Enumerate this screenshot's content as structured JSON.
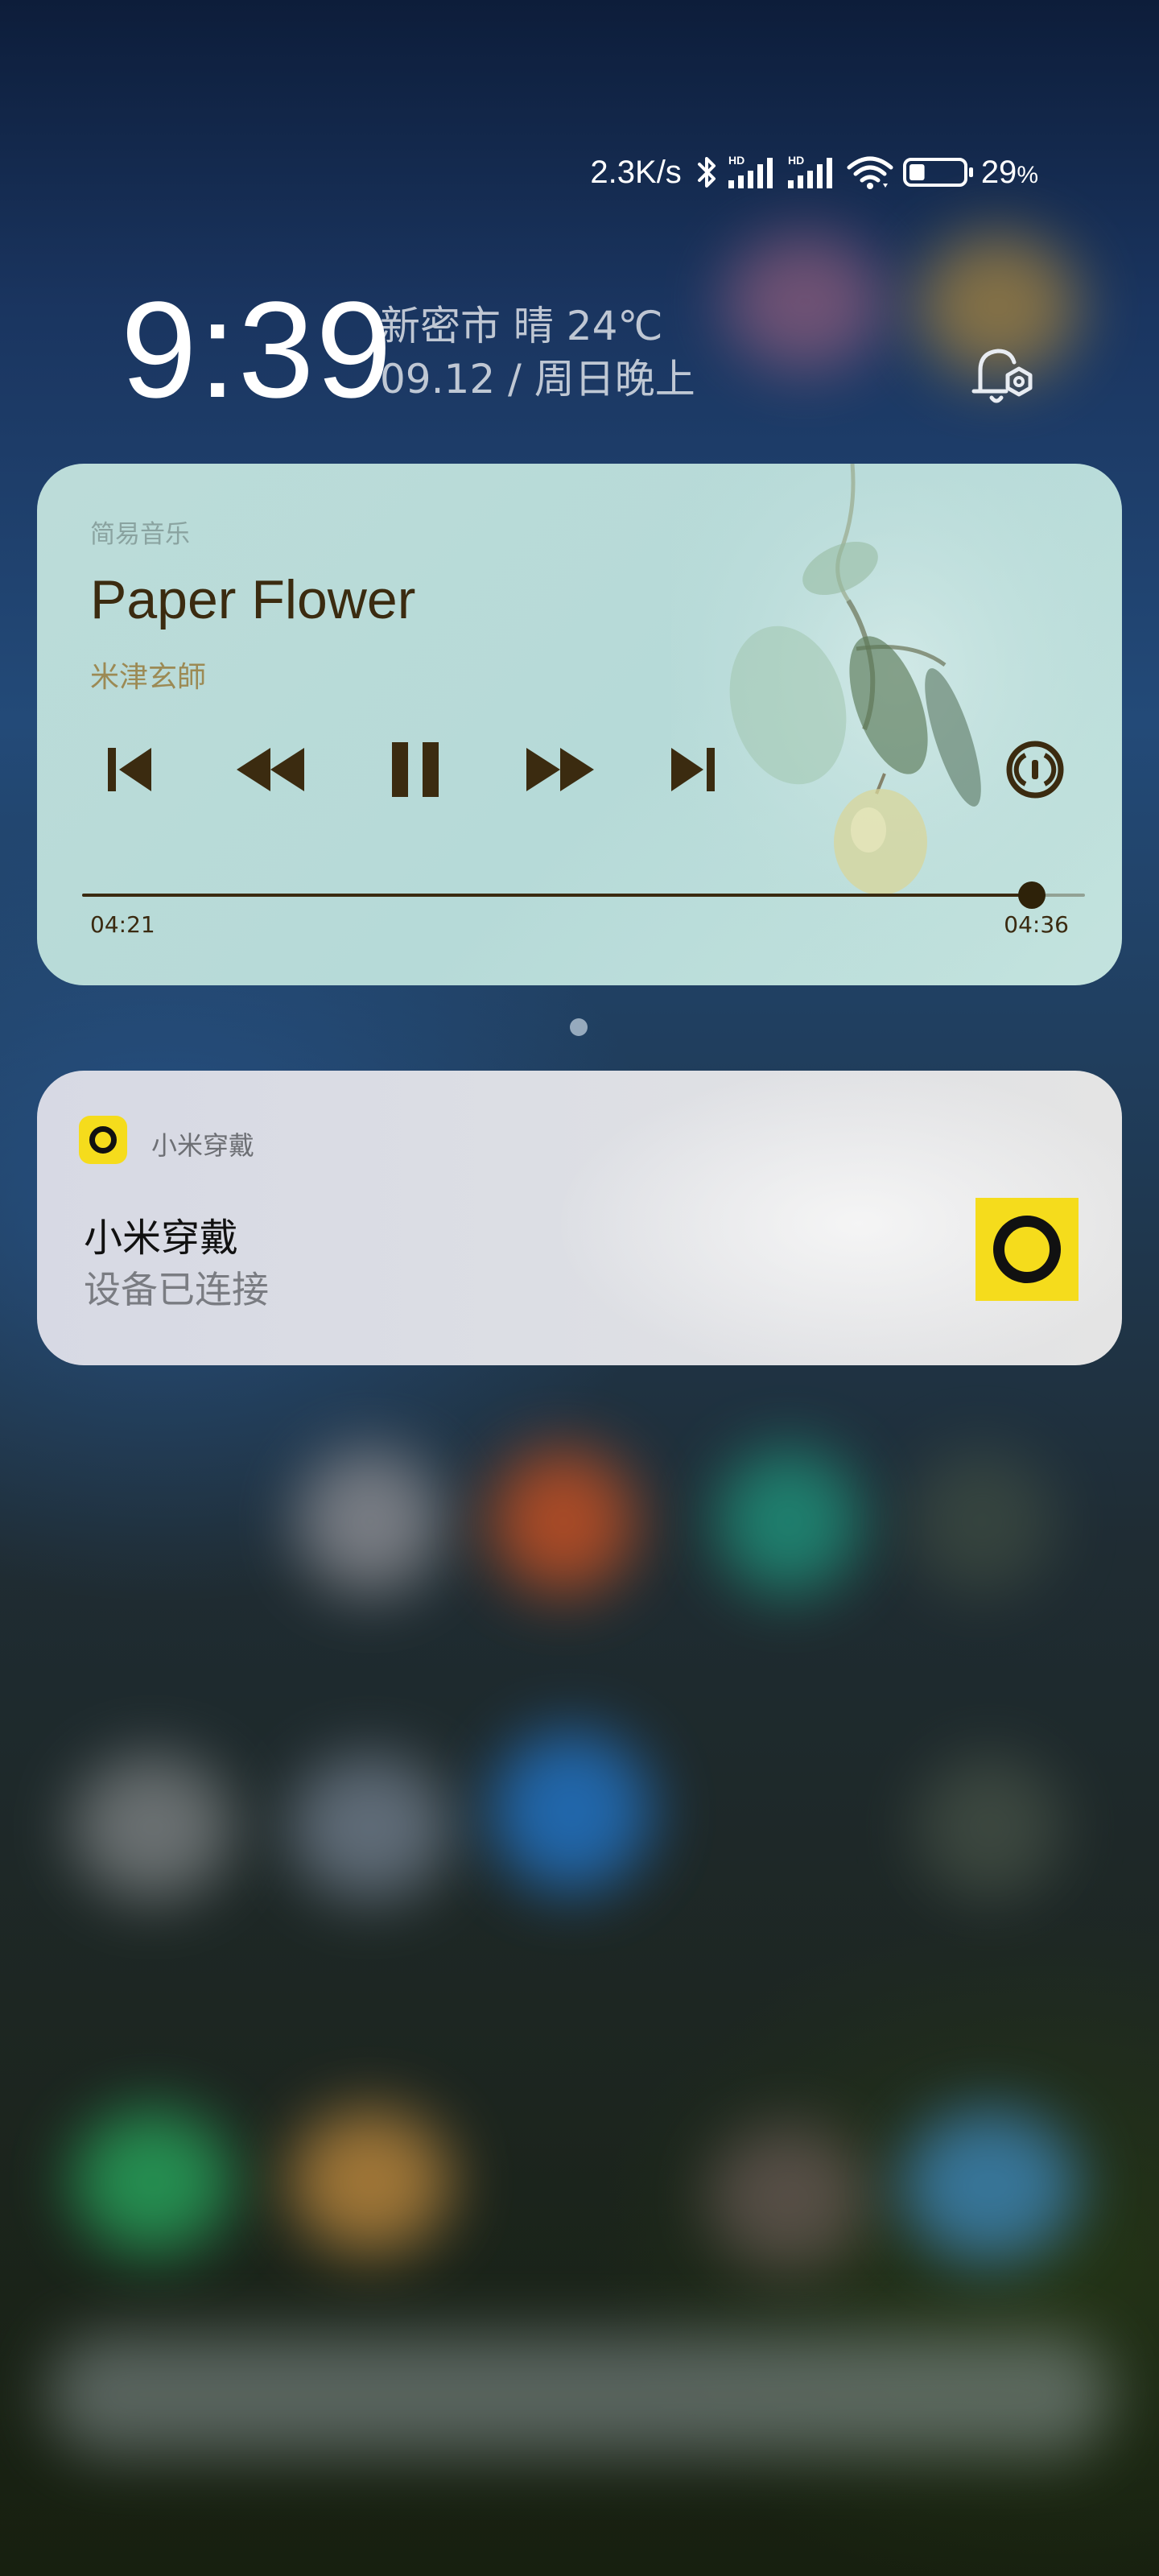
{
  "status_bar": {
    "network_speed": "2.3K/s",
    "battery_percent": "29",
    "battery_percent_sign": "%",
    "battery_level": 0.29
  },
  "clock": {
    "time": "9:39",
    "location_weather": "新密市 晴 24℃",
    "date_line": "09.12 / 周日晚上"
  },
  "music": {
    "app_name": "简易音乐",
    "title": "Paper Flower",
    "artist": "米津玄師",
    "current_time": "04:21",
    "total_time": "04:36",
    "progress": 0.947
  },
  "notification": {
    "app_name": "小米穿戴",
    "title": "小米穿戴",
    "body": "设备已连接"
  },
  "colors": {
    "music_card_bg": "#b9dbd8",
    "music_text": "#3b2b10",
    "artist_text": "#9c8a54",
    "notif_accent": "#f5dc1c"
  }
}
